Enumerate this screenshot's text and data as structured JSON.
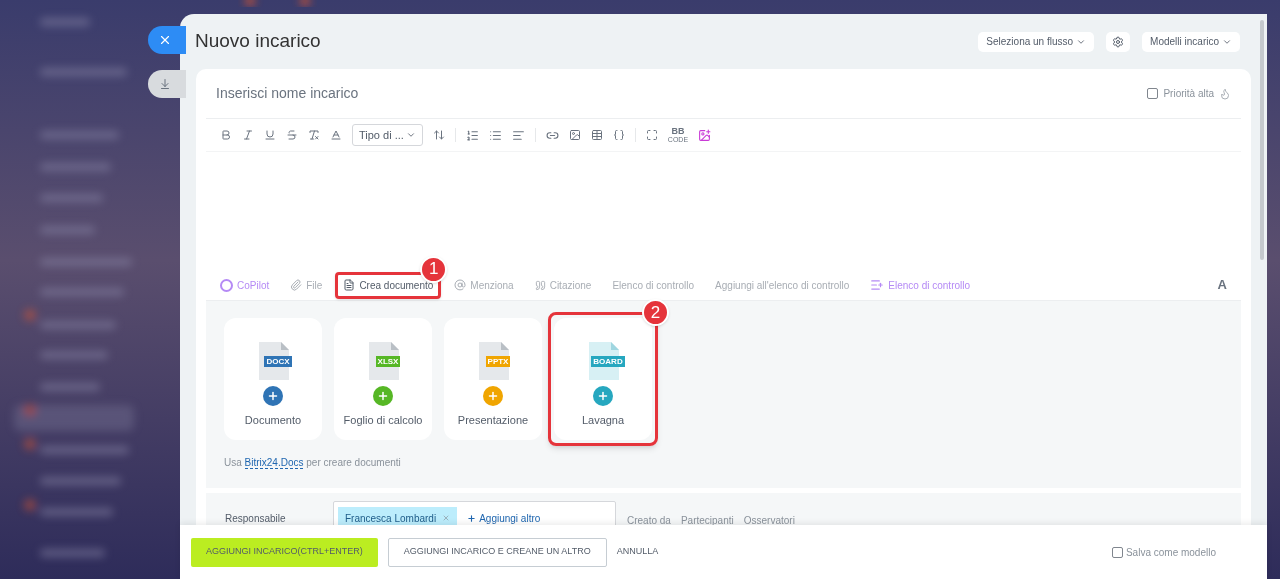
{
  "title": "Nuovo incarico",
  "header_controls": [
    {
      "kind": "dropdown",
      "label": "Seleziona un flusso"
    },
    {
      "kind": "settings"
    },
    {
      "kind": "dropdown",
      "label": "Modelli incarico"
    }
  ],
  "task_name": {
    "placeholder": "Inserisci nome incarico"
  },
  "high_priority": {
    "label": "Priorità alta",
    "checked": false
  },
  "format_toolbar": {
    "font_select": "Tipo di ...",
    "bbcode": {
      "label": "BB",
      "caption": "CODE"
    }
  },
  "attach_tabs": [
    {
      "kind": "copilot",
      "label": "CoPilot",
      "selected": false
    },
    {
      "kind": "file",
      "label": "File",
      "selected": false
    },
    {
      "kind": "document",
      "label": "Crea documento",
      "selected": true,
      "callout": "1"
    },
    {
      "kind": "mention",
      "label": "Menziona",
      "selected": false
    },
    {
      "kind": "quote",
      "label": "Citazione",
      "selected": false
    },
    {
      "kind": "text",
      "label": "Elenco di controllo",
      "selected": false
    },
    {
      "kind": "text",
      "label": "Aggiungi all'elenco di controllo",
      "selected": false
    },
    {
      "kind": "checklist",
      "label": "Elenco di controllo",
      "selected": false
    }
  ],
  "text_style_toggle": "A",
  "document_types": [
    {
      "label": "Documento",
      "badge": "DOCX",
      "color": "#2f74b5"
    },
    {
      "label": "Foglio di calcolo",
      "badge": "XLSX",
      "color": "#56b725"
    },
    {
      "label": "Presentazione",
      "badge": "PPTX",
      "color": "#f0a500"
    },
    {
      "label": "Lavagna",
      "badge": "BOARD",
      "color": "#26a7bf",
      "callout": "2"
    }
  ],
  "docs_hint": {
    "prefix": "Usa",
    "link": "Bitrix24.Docs",
    "suffix": "per creare documenti"
  },
  "responsible": {
    "label": "Responsabile",
    "people": [
      "Francesca Lombardi"
    ],
    "add_label": "Aggiungi altro"
  },
  "role_links": [
    "Creato da",
    "Partecipanti",
    "Osservatori"
  ],
  "footer_buttons": [
    {
      "kind": "primary",
      "label": "AGGIUNGI INCARICO(CTRL+ENTER)"
    },
    {
      "kind": "outline",
      "label": "AGGIUNGI INCARICO E CREANE UN ALTRO"
    },
    {
      "kind": "link",
      "label": "ANNULLA"
    }
  ],
  "save_template": {
    "label": "Salva come modello",
    "checked": false
  }
}
